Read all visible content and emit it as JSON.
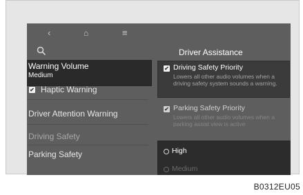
{
  "navbar": {
    "back_icon": "‹",
    "home_icon": "⌂",
    "menu_icon": "≡"
  },
  "left_menu": {
    "warning_volume_label": "Warning Volume",
    "warning_volume_value": "Medium",
    "haptic_warning_label": "Haptic Warning",
    "driver_attention_label": "Driver Attention Warning",
    "driving_safety_label": "Driving Safety",
    "parking_safety_label": "Parking Safety"
  },
  "right_panel": {
    "header": "Driver Assistance",
    "driving_safety_priority": {
      "label": "Driving Safety Priority",
      "description": "Lowers all other audio volumes when a driving safety system sounds a warning.",
      "checked": true
    },
    "parking_safety_priority": {
      "label": "Parking Safety Priority",
      "description": "Lowers all other audio volumes when a parking assist view is active",
      "checked": true
    },
    "volume_options": [
      "High",
      "Medium"
    ],
    "checkmark": "✔"
  },
  "caption": "B0312EU05"
}
